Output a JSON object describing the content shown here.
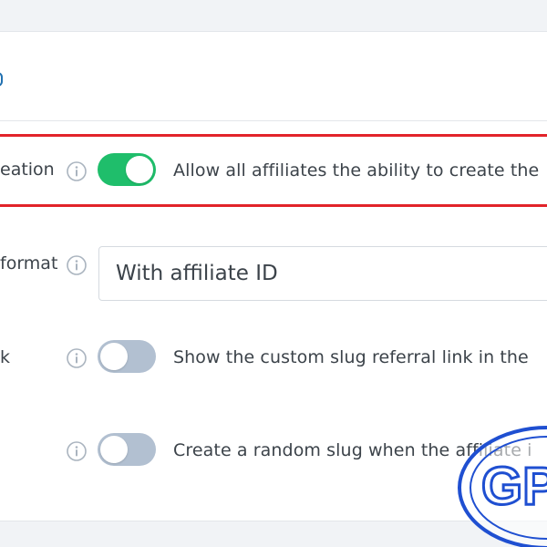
{
  "settings": {
    "rows": [
      {
        "label": "eation",
        "toggle_state": "on",
        "description": "Allow all affiliates the ability to create the",
        "highlighted": true
      },
      {
        "label": "format",
        "type": "select",
        "select_value": "With affiliate ID"
      },
      {
        "label": "k",
        "toggle_state": "off",
        "description": "Show the custom slug referral link in the"
      },
      {
        "label": "",
        "toggle_state": "off",
        "description": "Create a random slug when the affiliate i"
      }
    ]
  },
  "icons": {
    "info": "info-circle-icon",
    "toggle_on_color": "#1fbe6b",
    "toggle_off_color": "#b2c0d1",
    "highlight_color": "#e2242a",
    "watermark_color": "#1f4fd1"
  },
  "watermark": {
    "text": "GP"
  }
}
